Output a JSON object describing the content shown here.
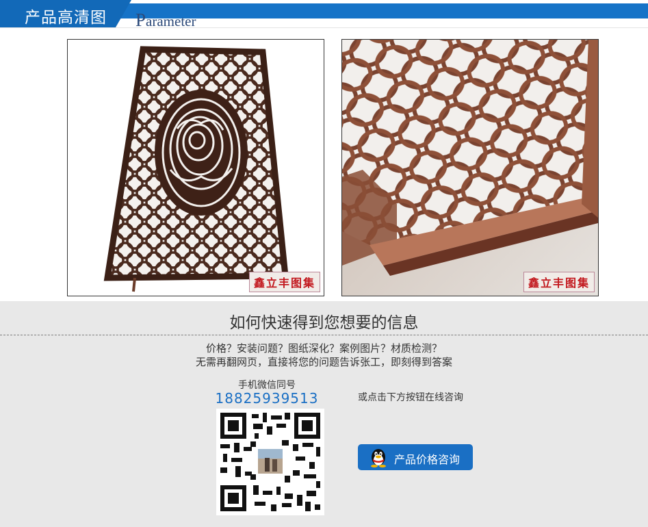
{
  "header": {
    "title": "产品高清图",
    "subtitle_cap": "P",
    "subtitle_rest": "arameter"
  },
  "photos": {
    "left": {
      "watermark": "鑫立丰图集"
    },
    "right": {
      "watermark": "鑫立丰图集"
    }
  },
  "info": {
    "title": "如何快速得到您想要的信息",
    "line1": "价格？安装问题？图纸深化？案例图片？材质检测？",
    "line2": "无需再翻网页，直接将您的问题告诉张工，即刻得到答案",
    "wechat_label": "手机微信同号",
    "phone": "18825939513",
    "or_text": "或点击下方按钮在线咨询",
    "button_label": "产品价格咨询"
  },
  "colors": {
    "brand_blue": "#1673c7",
    "phone_blue": "#1a6fc4",
    "watermark_red": "#c2171d"
  },
  "icons": {
    "button_icon": "qq-penguin-icon",
    "qr": "qr-code-icon"
  }
}
